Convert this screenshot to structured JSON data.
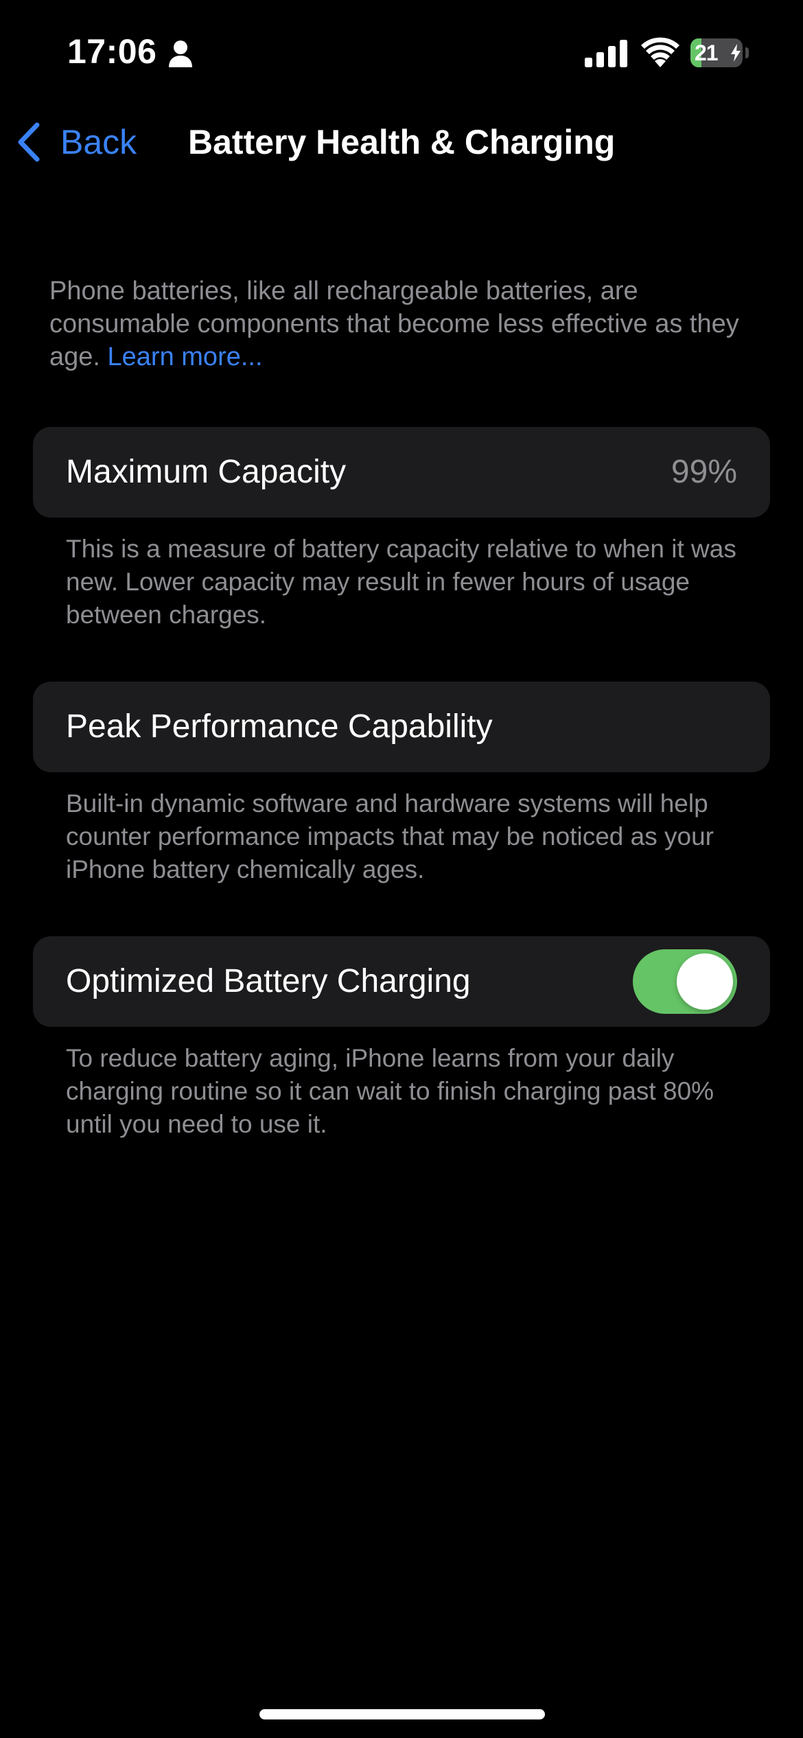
{
  "status_bar": {
    "time": "17:06",
    "battery_level": "21",
    "battery_fraction": 0.21,
    "icons": [
      "person-icon",
      "cellular-signal-icon",
      "wifi-icon",
      "battery-charging-icon"
    ]
  },
  "nav": {
    "back_label": "Back",
    "title": "Battery Health & Charging",
    "back_icon": "chevron-left-icon"
  },
  "intro": {
    "text": "Phone batteries, like all rechargeable batteries, are consumable components that become less effective as they age. ",
    "link": "Learn more..."
  },
  "maximum_capacity": {
    "label": "Maximum Capacity",
    "value": "99%",
    "footer": "This is a measure of battery capacity relative to when it was new. Lower capacity may result in fewer hours of usage between charges."
  },
  "peak_performance": {
    "label": "Peak Performance Capability",
    "footer": "Built-in dynamic software and hardware systems will help counter performance impacts that may be noticed as your iPhone battery chemically ages."
  },
  "optimized_charging": {
    "label": "Optimized Battery Charging",
    "enabled": true,
    "footer": "To reduce battery aging, iPhone learns from your daily charging routine so it can wait to finish charging past 80% until you need to use it."
  },
  "colors": {
    "background": "#000000",
    "cell": "#1c1c1e",
    "accent_blue": "#3a82f7",
    "toggle_green": "#65c466",
    "secondary_text": "#8e8e93"
  }
}
